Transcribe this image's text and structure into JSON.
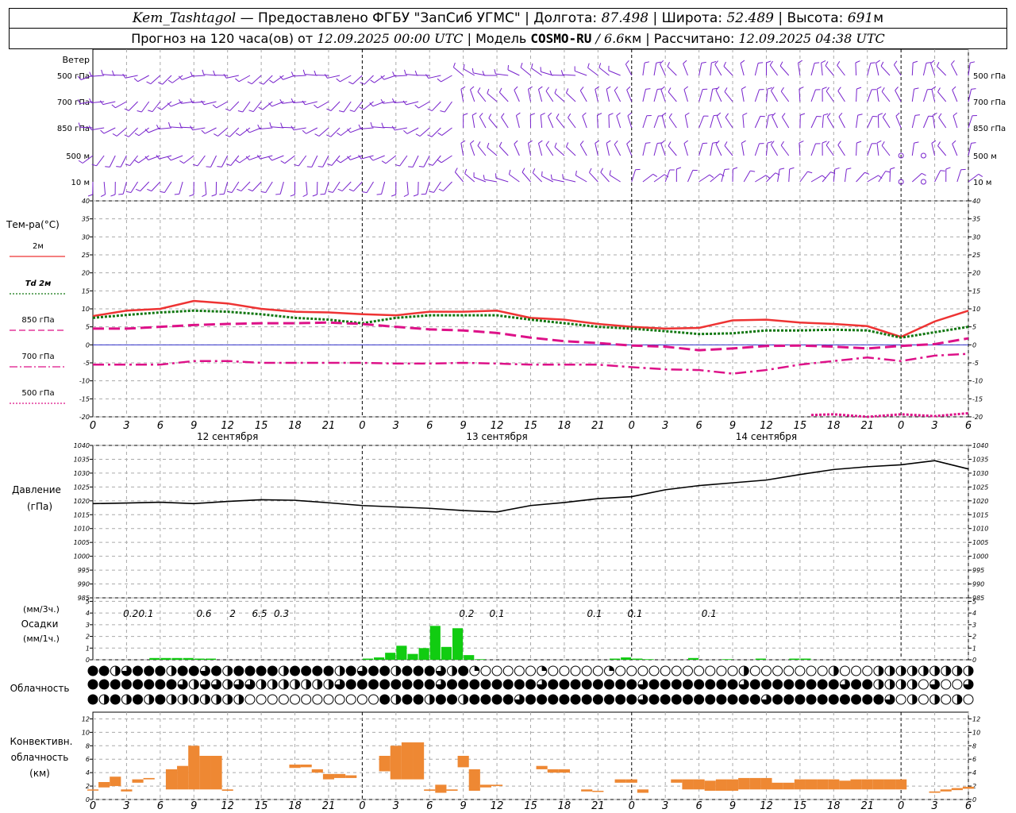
{
  "header": {
    "line1": {
      "station": "Kem_Tashtagol",
      "provider": " — Предоставлено ФГБУ \"ЗапСиб УГМС\" | ",
      "lon_label": "Долгота: ",
      "lon": "87.498",
      "lat_label": " | Широта: ",
      "lat": "52.489",
      "alt_label": " | Высота: ",
      "alt": "691",
      "alt_unit": "м"
    },
    "line2": {
      "forecast_label": "Прогноз на 120 часа(ов) от ",
      "forecast_start": "12.09.2025 00:00 UTC",
      "model_label": "  | Модель ",
      "model": "COSMO-RU",
      "model_sep": " / ",
      "resolution": "6.6",
      "resolution_unit": "км",
      "calc_label": " | Рассчитано: ",
      "calc_time": "12.09.2025 04:38 UTC"
    }
  },
  "axis": {
    "hour_ticks": [
      "0",
      "3",
      "6",
      "9",
      "12",
      "15",
      "18",
      "21",
      "0",
      "3",
      "6",
      "9",
      "12",
      "15",
      "18",
      "21",
      "0",
      "3",
      "6",
      "9",
      "12",
      "15",
      "18",
      "21",
      "0",
      "3",
      "6"
    ],
    "day_labels": [
      "12 сентября",
      "13 сентября",
      "14 сентября"
    ]
  },
  "panels": {
    "wind": {
      "title": "Ветер",
      "levels": [
        "500 гПа",
        "700 гПа",
        "850 гПа",
        "500 м",
        "10 м"
      ]
    },
    "temperature": {
      "title": "Тем-ра(°C)",
      "legend": [
        {
          "label": "2м",
          "color": "#ee3333",
          "style": "solid"
        },
        {
          "label": "Td 2м",
          "color": "#117711",
          "style": "dotted"
        },
        {
          "label": "850 гПа",
          "color": "#dd1188",
          "style": "dash"
        },
        {
          "label": "700 гПа",
          "color": "#dd1188",
          "style": "dashdot"
        },
        {
          "label": "500 гПа",
          "color": "#dd1188",
          "style": "dotted"
        }
      ],
      "ticks": [
        "40",
        "35",
        "30",
        "25",
        "20",
        "15",
        "10",
        "5",
        "0",
        "-5",
        "-10",
        "-15",
        "-20"
      ]
    },
    "pressure": {
      "title": "Давление",
      "unit": "(гПа)",
      "ticks": [
        "1040",
        "1035",
        "1030",
        "1025",
        "1020",
        "1015",
        "1010",
        "1005",
        "1000",
        "995",
        "990",
        "985"
      ]
    },
    "precip": {
      "unit_top": "(мм/3ч.)",
      "title": "Осадки",
      "unit_bottom": "(мм/1ч.)",
      "ticks": [
        "5",
        "4",
        "3",
        "2",
        "1",
        "0"
      ],
      "totals": [
        {
          "text": "0.2",
          "at": 0.625
        },
        {
          "text": "0.1",
          "at": 1.08
        },
        {
          "text": "0.6",
          "at": 2.8
        },
        {
          "text": "2",
          "at": 3.65
        },
        {
          "text": "6.5",
          "at": 4.45
        },
        {
          "text": "0.3",
          "at": 5.1
        },
        {
          "text": "0.2",
          "at": 10.6
        },
        {
          "text": "0.1",
          "at": 11.5
        },
        {
          "text": "0.1",
          "at": 14.4
        },
        {
          "text": "0.1",
          "at": 15.6
        },
        {
          "text": "0.1",
          "at": 17.8
        }
      ]
    },
    "clouds": {
      "title": "Облачность"
    },
    "convective": {
      "title_1": "Конвективн.",
      "title_2": "облачность",
      "unit": "(км)",
      "ticks": [
        "12",
        "10",
        "8",
        "6",
        "4",
        "2",
        "0"
      ]
    }
  },
  "colors": {
    "wind": "#7722cc",
    "t2m": "#ee3333",
    "td2m": "#117711",
    "t850": "#dd1188",
    "precip": "#11cc11",
    "convective": "#ee8833",
    "zero_line": "#3333cc",
    "grid": "#aaaaaa"
  },
  "chart_data": [
    {
      "type": "line",
      "title": "Тем-ра(°C)",
      "x_unit": "hours from 12.09.2025 00:00 UTC",
      "ylim": [
        -20,
        40
      ],
      "series": [
        {
          "name": "2м",
          "x": [
            0,
            3,
            6,
            9,
            12,
            15,
            18,
            21,
            24,
            27,
            30,
            33,
            36,
            39,
            42,
            45,
            48,
            51,
            54,
            57,
            60,
            63,
            66,
            69,
            72,
            75,
            78
          ],
          "values": [
            8,
            9.5,
            10,
            12.2,
            11.5,
            10,
            9.2,
            9,
            8.5,
            8.2,
            9.2,
            9.2,
            9.5,
            7.5,
            7,
            5.8,
            5,
            4.5,
            4.7,
            6.8,
            7,
            6.2,
            5.8,
            5.2,
            2.2,
            6.5,
            9.5
          ]
        },
        {
          "name": "Td 2м",
          "x": [
            0,
            3,
            6,
            9,
            12,
            15,
            18,
            21,
            24,
            27,
            30,
            33,
            36,
            39,
            42,
            45,
            48,
            51,
            54,
            57,
            60,
            63,
            66,
            69,
            72,
            75,
            78
          ],
          "values": [
            7.5,
            8.3,
            9,
            9.5,
            9.2,
            8.5,
            7.5,
            7,
            6,
            7.5,
            8.2,
            8.2,
            8.2,
            7,
            6,
            5,
            4.5,
            3.8,
            3,
            3.2,
            4,
            4,
            4.2,
            4,
            2,
            3.5,
            5
          ]
        },
        {
          "name": "850 гПа",
          "x": [
            0,
            3,
            6,
            9,
            12,
            15,
            18,
            21,
            24,
            27,
            30,
            33,
            36,
            39,
            42,
            45,
            48,
            51,
            54,
            57,
            60,
            63,
            66,
            69,
            72,
            75,
            78
          ],
          "values": [
            4.5,
            4.5,
            5,
            5.5,
            5.8,
            6,
            6,
            6.2,
            5.8,
            5,
            4.3,
            4,
            3.3,
            2,
            1,
            0.5,
            -0.2,
            -0.5,
            -1.5,
            -1,
            -0.3,
            -0.2,
            -0.5,
            -1,
            -0.3,
            0.2,
            1.8
          ]
        },
        {
          "name": "700 гПа",
          "x": [
            0,
            3,
            6,
            9,
            12,
            15,
            18,
            21,
            24,
            27,
            30,
            33,
            36,
            39,
            42,
            45,
            48,
            51,
            54,
            57,
            60,
            63,
            66,
            69,
            72,
            75,
            78
          ],
          "values": [
            -5.5,
            -5.5,
            -5.5,
            -4.5,
            -4.5,
            -5,
            -5,
            -5,
            -5,
            -5.2,
            -5.2,
            -5,
            -5.2,
            -5.5,
            -5.5,
            -5.5,
            -6.2,
            -6.8,
            -7,
            -8,
            -7,
            -5.5,
            -4.5,
            -3.5,
            -4.5,
            -3,
            -2.5
          ]
        },
        {
          "name": "500 гПа",
          "x": [
            64,
            66,
            69,
            72,
            75,
            78
          ],
          "values": [
            -19.5,
            -19.3,
            -20,
            -19.3,
            -19.8,
            -19
          ]
        }
      ]
    },
    {
      "type": "line",
      "title": "Давление",
      "ylabel": "(гПа)",
      "x_unit": "hours from 12.09.2025 00:00 UTC",
      "ylim": [
        985,
        1040
      ],
      "series": [
        {
          "name": "",
          "x": [
            0,
            3,
            6,
            9,
            12,
            15,
            18,
            21,
            24,
            27,
            30,
            33,
            36,
            39,
            42,
            45,
            48,
            51,
            54,
            57,
            60,
            63,
            66,
            69,
            72,
            75,
            78
          ],
          "values": [
            1019,
            1019.2,
            1019.5,
            1019,
            1019.8,
            1020.4,
            1020.2,
            1019.3,
            1018.3,
            1017.8,
            1017.3,
            1016.5,
            1016,
            1018.3,
            1019.4,
            1020.8,
            1021.5,
            1024,
            1025.5,
            1026.5,
            1027.5,
            1029.5,
            1031.3,
            1032.3,
            1033,
            1034.5,
            1031.5
          ]
        }
      ]
    },
    {
      "type": "bar",
      "title": "Осадки",
      "ylabel": "(мм/1ч.)",
      "x_unit": "hours from 12.09.2025 00:00 UTC",
      "ylim": [
        0,
        5
      ],
      "x": [
        6,
        7,
        8,
        9,
        10,
        11,
        25,
        26,
        27,
        28,
        29,
        30,
        31,
        32,
        33,
        34,
        35,
        47,
        48,
        49,
        50,
        54,
        57,
        60,
        63,
        64
      ],
      "values": [
        0.15,
        0.15,
        0.15,
        0.15,
        0.1,
        0.1,
        0.1,
        0.2,
        0.6,
        1.2,
        0.5,
        1,
        2.9,
        1.1,
        2.7,
        0.4,
        0.05,
        0.1,
        0.2,
        0.1,
        0.05,
        0.15,
        0.05,
        0.1,
        0.1,
        0.1
      ]
    },
    {
      "type": "bar",
      "title": "Конвективн. облачность",
      "ylabel": "(км)",
      "x_unit": "hours from 12.09.2025 00:00 UTC",
      "ylim": [
        0,
        12
      ],
      "bars": [
        {
          "x": 0,
          "base": 1.5,
          "top": 1.5
        },
        {
          "x": 1,
          "base": 1.8,
          "top": 2.6
        },
        {
          "x": 2,
          "base": 2,
          "top": 3.4
        },
        {
          "x": 3,
          "base": 1.2,
          "top": 1.5
        },
        {
          "x": 4,
          "base": 2.5,
          "top": 3
        },
        {
          "x": 5,
          "base": 3,
          "top": 3.2
        },
        {
          "x": 7,
          "base": 1.5,
          "top": 4.5
        },
        {
          "x": 8,
          "base": 1.5,
          "top": 5
        },
        {
          "x": 9,
          "base": 1.5,
          "top": 8
        },
        {
          "x": 10,
          "base": 1.5,
          "top": 6.5
        },
        {
          "x": 11,
          "base": 1.5,
          "top": 6.5
        },
        {
          "x": 12,
          "base": 1.3,
          "top": 1.5
        },
        {
          "x": 18,
          "base": 4.7,
          "top": 5.2
        },
        {
          "x": 19,
          "base": 4.8,
          "top": 5.2
        },
        {
          "x": 20,
          "base": 4,
          "top": 4.5
        },
        {
          "x": 21,
          "base": 3,
          "top": 3.8
        },
        {
          "x": 22,
          "base": 3.2,
          "top": 3.8
        },
        {
          "x": 23,
          "base": 3.2,
          "top": 3.6
        },
        {
          "x": 26,
          "base": 4.2,
          "top": 6.5
        },
        {
          "x": 27,
          "base": 3,
          "top": 8
        },
        {
          "x": 28,
          "base": 3,
          "top": 8.5
        },
        {
          "x": 29,
          "base": 3,
          "top": 8.5
        },
        {
          "x": 30,
          "base": 1.3,
          "top": 1.5
        },
        {
          "x": 31,
          "base": 1,
          "top": 2.2
        },
        {
          "x": 32,
          "base": 1.3,
          "top": 1.5
        },
        {
          "x": 33,
          "base": 4.8,
          "top": 6.5
        },
        {
          "x": 34,
          "base": 1.3,
          "top": 4.5
        },
        {
          "x": 35,
          "base": 1.8,
          "top": 2.2
        },
        {
          "x": 36,
          "base": 2,
          "top": 2.2
        },
        {
          "x": 40,
          "base": 4.5,
          "top": 5
        },
        {
          "x": 41,
          "base": 4,
          "top": 4.5
        },
        {
          "x": 42,
          "base": 4,
          "top": 4.5
        },
        {
          "x": 44,
          "base": 1.2,
          "top": 1.5
        },
        {
          "x": 45,
          "base": 1.2,
          "top": 1.3
        },
        {
          "x": 47,
          "base": 2.5,
          "top": 3
        },
        {
          "x": 48,
          "base": 2.5,
          "top": 3
        },
        {
          "x": 49,
          "base": 1,
          "top": 1.5
        },
        {
          "x": 52,
          "base": 2.5,
          "top": 3
        },
        {
          "x": 53,
          "base": 1.5,
          "top": 3
        },
        {
          "x": 54,
          "base": 1.5,
          "top": 3
        },
        {
          "x": 55,
          "base": 1.3,
          "top": 2.8
        },
        {
          "x": 56,
          "base": 1.3,
          "top": 3
        },
        {
          "x": 57,
          "base": 1.3,
          "top": 3
        },
        {
          "x": 58,
          "base": 1.5,
          "top": 3.2
        },
        {
          "x": 59,
          "base": 1.5,
          "top": 3.2
        },
        {
          "x": 60,
          "base": 1.5,
          "top": 3.2
        },
        {
          "x": 61,
          "base": 1.5,
          "top": 2.5
        },
        {
          "x": 62,
          "base": 1.5,
          "top": 2.5
        },
        {
          "x": 63,
          "base": 1.5,
          "top": 3
        },
        {
          "x": 64,
          "base": 1.5,
          "top": 3
        },
        {
          "x": 65,
          "base": 1.5,
          "top": 3
        },
        {
          "x": 66,
          "base": 1.5,
          "top": 3
        },
        {
          "x": 67,
          "base": 1.5,
          "top": 2.8
        },
        {
          "x": 68,
          "base": 1.5,
          "top": 3
        },
        {
          "x": 69,
          "base": 1.5,
          "top": 3
        },
        {
          "x": 70,
          "base": 1.5,
          "top": 3
        },
        {
          "x": 71,
          "base": 1.5,
          "top": 3
        },
        {
          "x": 72,
          "base": 1.5,
          "top": 3
        },
        {
          "x": 75,
          "base": 1,
          "top": 1.2
        },
        {
          "x": 76,
          "base": 1.2,
          "top": 1.5
        },
        {
          "x": 77,
          "base": 1.4,
          "top": 1.7
        },
        {
          "x": 78,
          "base": 1.6,
          "top": 1.9
        }
      ]
    }
  ]
}
